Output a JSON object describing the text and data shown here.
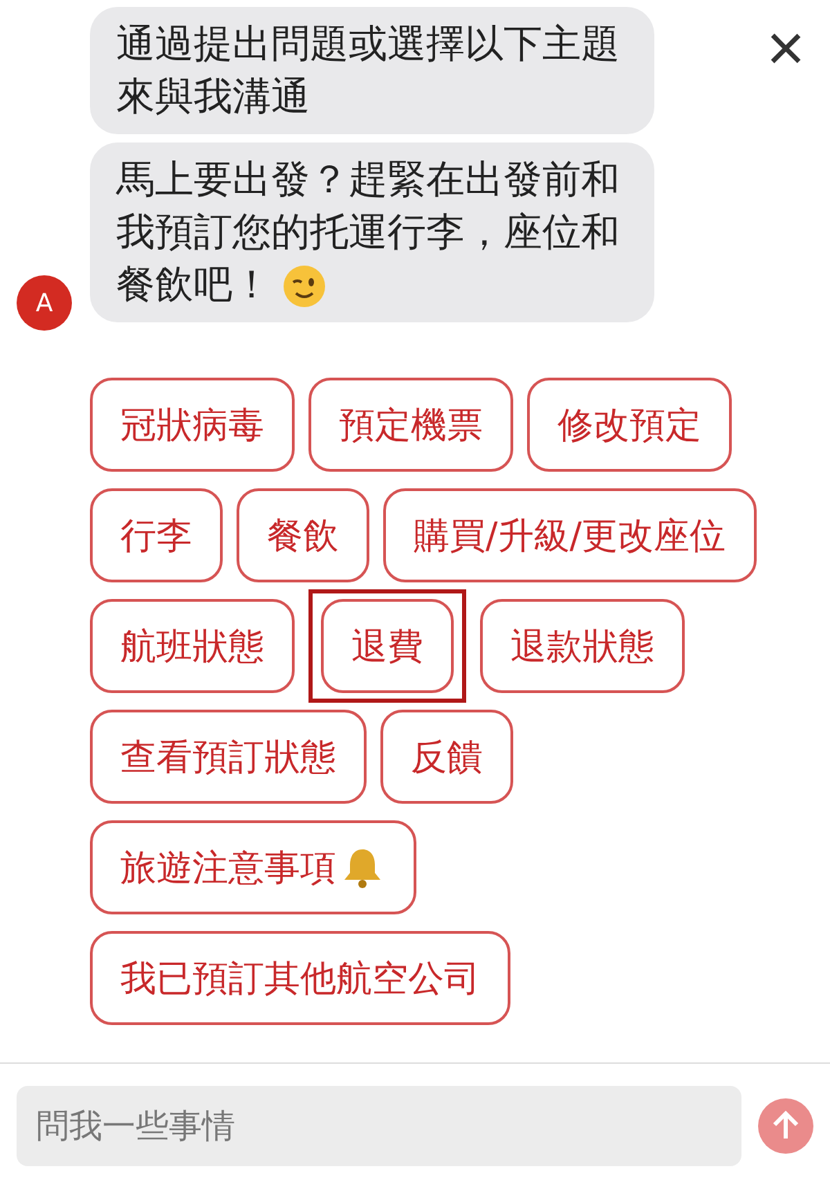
{
  "header": {
    "close": "×"
  },
  "messages": [
    {
      "text": "通過提出問題或選擇以下主題來與我溝通",
      "kind": "plain"
    },
    {
      "text": "馬上要出發？趕緊在出發前和我預訂您的托運行李，座位和餐飲吧！",
      "kind": "wink"
    }
  ],
  "avatar": {
    "letter": "A"
  },
  "quick_replies": [
    {
      "label": "冠狀病毒",
      "highlighted": false,
      "kind": "text"
    },
    {
      "label": "預定機票",
      "highlighted": false,
      "kind": "text"
    },
    {
      "label": "修改預定",
      "highlighted": false,
      "kind": "text"
    },
    {
      "label": "行李",
      "highlighted": false,
      "kind": "text"
    },
    {
      "label": "餐飲",
      "highlighted": false,
      "kind": "text"
    },
    {
      "label": "購買/升級/更改座位",
      "highlighted": false,
      "kind": "text"
    },
    {
      "label": "航班狀態",
      "highlighted": false,
      "kind": "text"
    },
    {
      "label": "退費",
      "highlighted": true,
      "kind": "text"
    },
    {
      "label": "退款狀態",
      "highlighted": false,
      "kind": "text"
    },
    {
      "label": "查看預訂狀態",
      "highlighted": false,
      "kind": "text"
    },
    {
      "label": "反饋",
      "highlighted": false,
      "kind": "text"
    },
    {
      "label": "旅遊注意事項",
      "highlighted": false,
      "kind": "bell"
    },
    {
      "label": "我已預訂其他航空公司",
      "highlighted": false,
      "kind": "text"
    }
  ],
  "composer": {
    "placeholder": "問我一些事情"
  }
}
